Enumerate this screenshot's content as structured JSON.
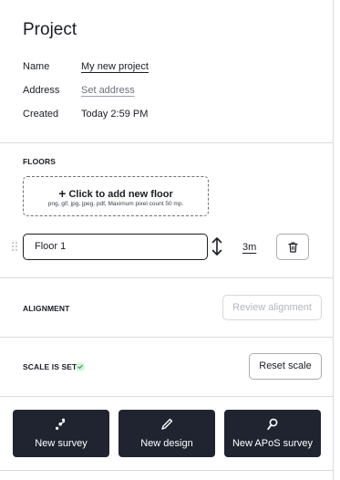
{
  "project": {
    "title": "Project",
    "fields": [
      {
        "label": "Name",
        "value": "My new project"
      },
      {
        "label": "Address",
        "value": "Set address"
      },
      {
        "label": "Created",
        "value": "Today 2:59 PM"
      }
    ]
  },
  "floors": {
    "heading": "FLOORS",
    "add_title": "Click to add new floor",
    "add_subtitle": "png, gif, jpg, jpeg, pdf, Maximum pixel count 50 mp.",
    "items": [
      {
        "name": "Floor 1",
        "height": "3m"
      }
    ]
  },
  "alignment": {
    "heading": "ALIGNMENT",
    "review_label": "Review alignment"
  },
  "scale": {
    "heading": "SCALE IS SET",
    "reset_label": "Reset scale"
  },
  "actions": [
    {
      "label": "New survey",
      "icon": "survey-icon"
    },
    {
      "label": "New design",
      "icon": "pen-icon"
    },
    {
      "label": "New APoS survey",
      "icon": "apos-pin-icon"
    }
  ],
  "colors": {
    "dark_card": "#1f2430",
    "border": "#d9dadd",
    "check_green": "#2fa84f"
  }
}
